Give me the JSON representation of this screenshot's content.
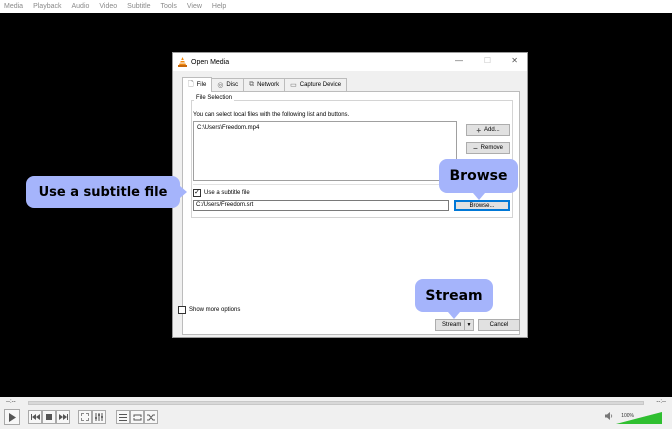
{
  "menubar": {
    "items": [
      "Media",
      "Playback",
      "Audio",
      "Video",
      "Subtitle",
      "Tools",
      "View",
      "Help"
    ]
  },
  "player": {
    "time_elapsed": "--:--",
    "time_total": "--:--",
    "volume_label": "100%",
    "volume_level": 1.0
  },
  "dialog": {
    "title": "Open Media",
    "tabs": [
      {
        "label": "File",
        "icon": "file-icon",
        "active": true
      },
      {
        "label": "Disc",
        "icon": "disc-icon",
        "active": false
      },
      {
        "label": "Network",
        "icon": "network-icon",
        "active": false
      },
      {
        "label": "Capture Device",
        "icon": "capture-device-icon",
        "active": false
      }
    ],
    "file_selection": {
      "group_label": "File Selection",
      "hint": "You can select local files with the following list and buttons.",
      "files": [
        "C:\\Users\\Freedom.mp4"
      ],
      "add_label": "Add...",
      "remove_label": "Remove"
    },
    "subtitle": {
      "checkbox_label": "Use a subtitle file",
      "checked": true,
      "path": "C:/Users/Freedom.srt",
      "browse_label": "Browse..."
    },
    "show_more_label": "Show more options",
    "show_more_checked": false,
    "stream_label": "Stream",
    "cancel_label": "Cancel"
  },
  "callouts": {
    "subtitle": "Use a subtitle file",
    "browse": "Browse",
    "stream": "Stream"
  },
  "colors": {
    "callout": "#a5b4fb",
    "accent": "#0078d7",
    "volume_green": "#2fbf30"
  }
}
